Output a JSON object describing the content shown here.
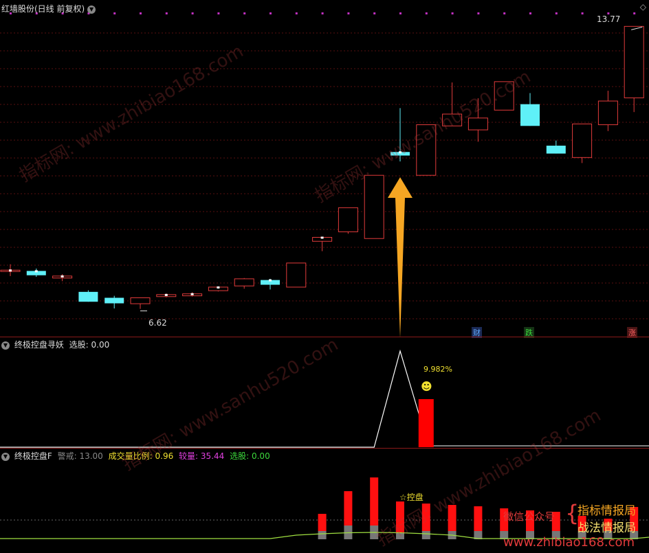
{
  "main": {
    "title": "红墙股份(日线 前复权)",
    "high_label": "13.77",
    "low_label": "6.62",
    "event_badges": [
      {
        "text": "财",
        "color": "#5fa8ff"
      },
      {
        "text": "跌",
        "color": "#3cd93c"
      },
      {
        "text": "涨",
        "color": "#ff6060"
      }
    ],
    "candles": [
      {
        "o": 7.6,
        "c": 7.6,
        "h": 7.75,
        "l": 7.45
      },
      {
        "o": 7.58,
        "c": 7.47,
        "h": 7.64,
        "l": 7.43
      },
      {
        "o": 7.4,
        "c": 7.45,
        "h": 7.5,
        "l": 7.32
      },
      {
        "o": 7.05,
        "c": 6.8,
        "h": 7.09,
        "l": 6.8
      },
      {
        "o": 6.9,
        "c": 6.76,
        "h": 6.95,
        "l": 6.63
      },
      {
        "o": 6.75,
        "c": 6.9,
        "h": 6.9,
        "l": 6.62
      },
      {
        "o": 6.93,
        "c": 6.98,
        "h": 7.01,
        "l": 6.91
      },
      {
        "o": 6.95,
        "c": 7.0,
        "h": 7.04,
        "l": 6.93
      },
      {
        "o": 7.08,
        "c": 7.17,
        "h": 7.19,
        "l": 7.06
      },
      {
        "o": 7.2,
        "c": 7.38,
        "h": 7.4,
        "l": 7.13
      },
      {
        "o": 7.35,
        "c": 7.23,
        "h": 7.38,
        "l": 7.11
      },
      {
        "o": 7.17,
        "c": 7.78,
        "h": 7.78,
        "l": 7.17
      },
      {
        "o": 8.33,
        "c": 8.43,
        "h": 8.43,
        "l": 8.08
      },
      {
        "o": 8.57,
        "c": 9.18,
        "h": 9.18,
        "l": 8.52
      },
      {
        "o": 8.4,
        "c": 10.0,
        "h": 10.0,
        "l": 8.4
      },
      {
        "o": 10.59,
        "c": 10.5,
        "h": 11.7,
        "l": 10.35
      },
      {
        "o": 10.0,
        "c": 11.28,
        "h": 11.28,
        "l": 10.0
      },
      {
        "o": 11.25,
        "c": 11.55,
        "h": 12.35,
        "l": 11.25
      },
      {
        "o": 11.15,
        "c": 11.45,
        "h": 11.95,
        "l": 10.85
      },
      {
        "o": 11.65,
        "c": 12.37,
        "h": 12.37,
        "l": 11.65
      },
      {
        "o": 11.8,
        "c": 11.25,
        "h": 12.08,
        "l": 11.25
      },
      {
        "o": 10.75,
        "c": 10.55,
        "h": 10.88,
        "l": 10.55
      },
      {
        "o": 10.45,
        "c": 11.3,
        "h": 11.3,
        "l": 10.31
      },
      {
        "o": 11.28,
        "c": 11.88,
        "h": 12.14,
        "l": 11.12
      },
      {
        "o": 11.96,
        "c": 13.77,
        "h": 13.77,
        "l": 11.6
      }
    ],
    "price_range": [
      6.3,
      13.95
    ],
    "arrow_color": "#f5a623",
    "up_color": "#e23b3b",
    "down_color": "#5ff0f8"
  },
  "indicator1": {
    "name": "终极控盘寻妖",
    "field_label": "选股:",
    "field_value": "0.00",
    "pct_label": "9.982%",
    "smiley": "☻",
    "signal_bar_index": 16,
    "signal_bar_value": 1.0,
    "line_peak_index": 15
  },
  "indicator2": {
    "name": "终极控盘F",
    "warn_label": "警戒:",
    "warn_value": "13.00",
    "ratio_label": "成交量比例:",
    "ratio_value": "0.96",
    "comp_label": "较量:",
    "comp_value": "35.44",
    "pick_label": "选股:",
    "pick_value": "0.00",
    "star_label": "☆控盘",
    "red_bars": [
      0,
      0,
      0,
      0,
      0,
      0,
      0,
      0,
      0,
      0,
      0,
      0,
      25,
      50,
      70,
      45,
      40,
      38,
      36,
      33,
      30,
      28,
      22,
      18,
      35
    ],
    "gray_bars": [
      0,
      0,
      0,
      0,
      0,
      0,
      0,
      0,
      0,
      0,
      0,
      0,
      12,
      20,
      20,
      10,
      12,
      12,
      12,
      12,
      12,
      12,
      12,
      12,
      12
    ]
  },
  "promo": {
    "wechat_label": "微信公众号",
    "line1": "指标情报局",
    "line2": "战法情报局",
    "site": "www.zhibiao168.com"
  },
  "watermarks": [
    "指标网: www.zhibiao168.com",
    "指标网: www.sanhu520.com",
    "指标网: www.sanhu520.com",
    "指标网: www.zhibiao168.com"
  ]
}
